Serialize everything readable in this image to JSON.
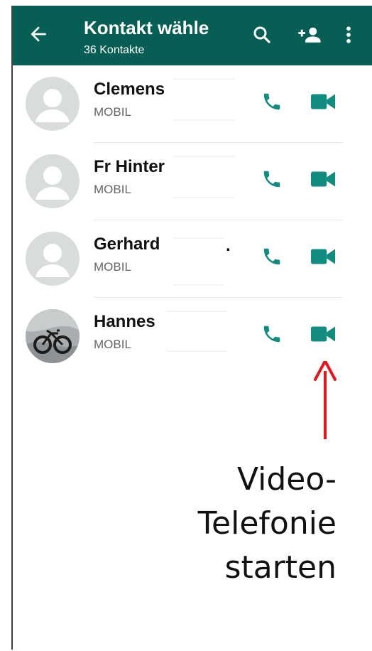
{
  "appbar": {
    "title": "Kontakt wähle",
    "subtitle": "36 Kontakte"
  },
  "contacts": [
    {
      "name": "Clemens",
      "type": "MOBIL"
    },
    {
      "name": "Fr Hinter",
      "type": "MOBIL"
    },
    {
      "name": "Gerhard",
      "type": "MOBIL",
      "suffix": "."
    },
    {
      "name": "Hannes",
      "type": "MOBIL"
    }
  ],
  "annotation": {
    "lines": [
      "Video-",
      "Telefonie",
      "starten"
    ],
    "arrow_color": "#e8141a"
  },
  "colors": {
    "appbar": "#075e54",
    "icon_green": "#128c7e"
  },
  "icons": {
    "back": "arrow-left-icon",
    "search": "search-icon",
    "add_person": "add-person-icon",
    "more": "more-vert-icon",
    "phone": "phone-icon",
    "video": "video-camera-icon"
  }
}
